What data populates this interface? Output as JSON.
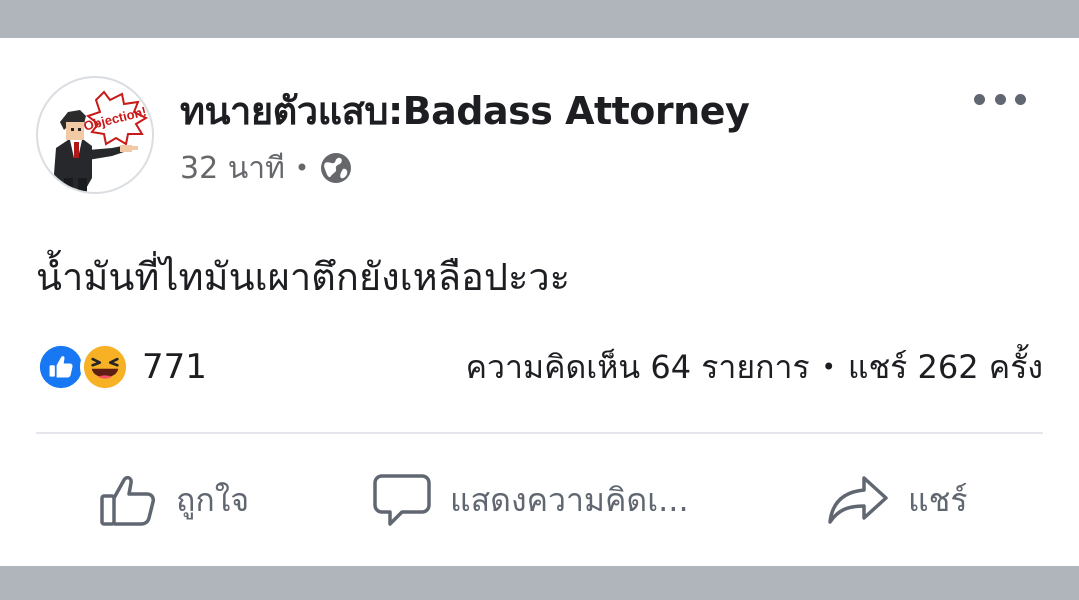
{
  "post": {
    "page_name": "ทนายตัวแสบ:Badass Attorney",
    "time": "32 นาที",
    "separator": "•",
    "privacy_icon": "globe-icon",
    "avatar_caption": "Objection!",
    "text": "น้ำมันที่ไทมันเผาตึกยังเหลือปะวะ"
  },
  "stats": {
    "reaction_icons": [
      "like-reaction-icon",
      "haha-reaction-icon"
    ],
    "reaction_count": "771",
    "comments": "ความคิดเห็น 64 รายการ",
    "separator": "•",
    "shares": "แชร์ 262 ครั้ง"
  },
  "actions": {
    "like": {
      "label": "ถูกใจ",
      "icon": "thumbs-up-icon"
    },
    "comment": {
      "label": "แสดงความคิดเ...",
      "icon": "speech-bubble-icon"
    },
    "share": {
      "label": "แชร์",
      "icon": "share-arrow-icon"
    }
  },
  "colors": {
    "band": "#b0b5bc",
    "text": "#1c1e21",
    "muted": "#65676b",
    "like_blue": "#1877f2",
    "haha_yellow": "#f7b125"
  }
}
